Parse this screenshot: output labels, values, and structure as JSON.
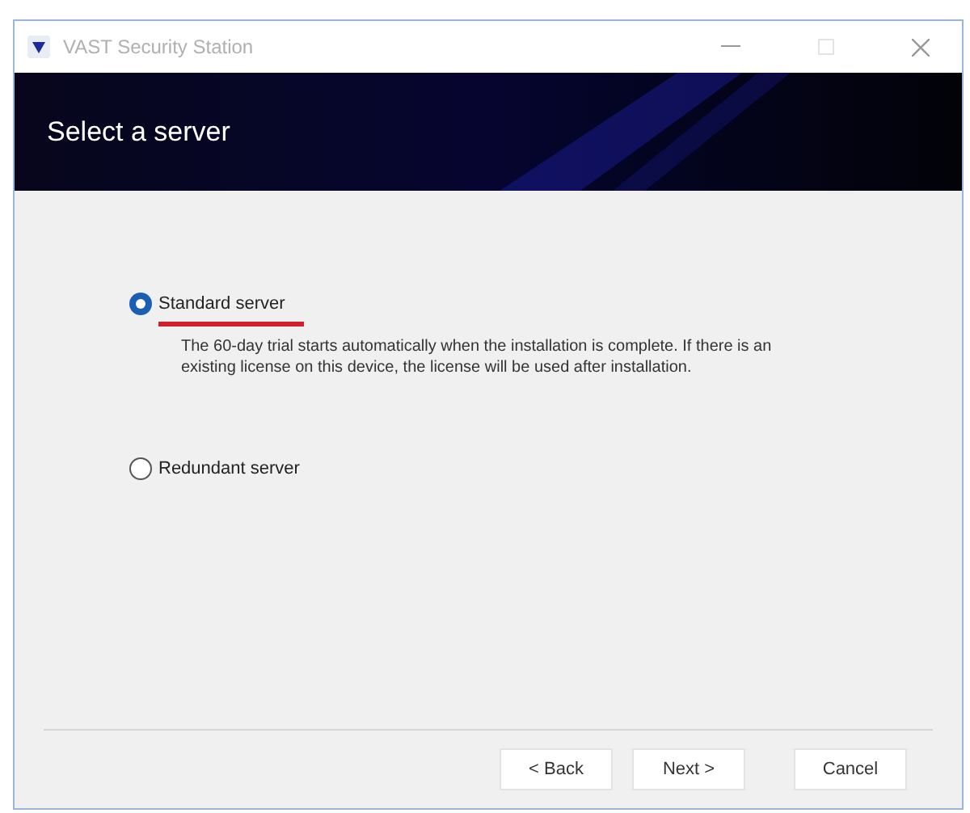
{
  "window": {
    "title": "VAST Security Station"
  },
  "header": {
    "title": "Select a server"
  },
  "options": [
    {
      "label": "Standard server",
      "selected": true,
      "underlined": true,
      "description": "The 60-day trial starts automatically when the installation is complete. If there is an existing license on this device, the license will be used after installation."
    },
    {
      "label": "Redundant server",
      "selected": false,
      "underlined": false
    }
  ],
  "buttons": [
    {
      "label": "< Back"
    },
    {
      "label": "Next >"
    },
    {
      "label": "Cancel"
    }
  ]
}
